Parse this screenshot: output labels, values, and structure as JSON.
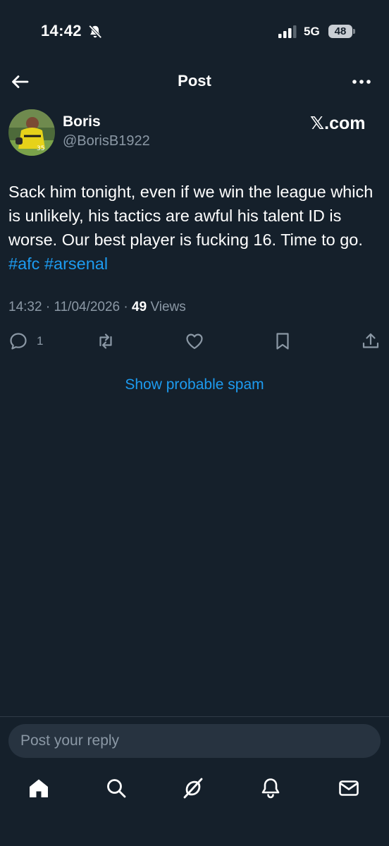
{
  "status_bar": {
    "time": "14:42",
    "network": "5G",
    "battery": "48"
  },
  "header": {
    "title": "Post"
  },
  "author": {
    "name": "Boris",
    "handle": "@BorisB1922",
    "source": "𝕏.com"
  },
  "post": {
    "text": "Sack him tonight, even if we win the league which is unlikely, his tactics are awful his talent ID is worse. Our best player is fucking 16. Time to go.",
    "hashtags": [
      "#afc",
      "#arsenal"
    ],
    "time": "14:32",
    "date": "11/04/2026",
    "views_count": "49",
    "views_label": "Views",
    "reply_count": "1"
  },
  "spam_link": "Show probable spam",
  "reply_box": {
    "placeholder": "Post your reply"
  },
  "icons": {
    "back": "arrow-left-icon",
    "more": "more-horizontal-icon",
    "reply": "comment-icon",
    "retweet": "retweet-icon",
    "like": "heart-icon",
    "bookmark": "bookmark-icon",
    "share": "share-icon",
    "home": "home-icon",
    "search": "search-icon",
    "grok": "grok-icon",
    "notifications": "bell-icon",
    "messages": "mail-icon"
  },
  "colors": {
    "background": "#15202b",
    "accent": "#1d9bf0",
    "secondary_text": "#8b98a5"
  }
}
